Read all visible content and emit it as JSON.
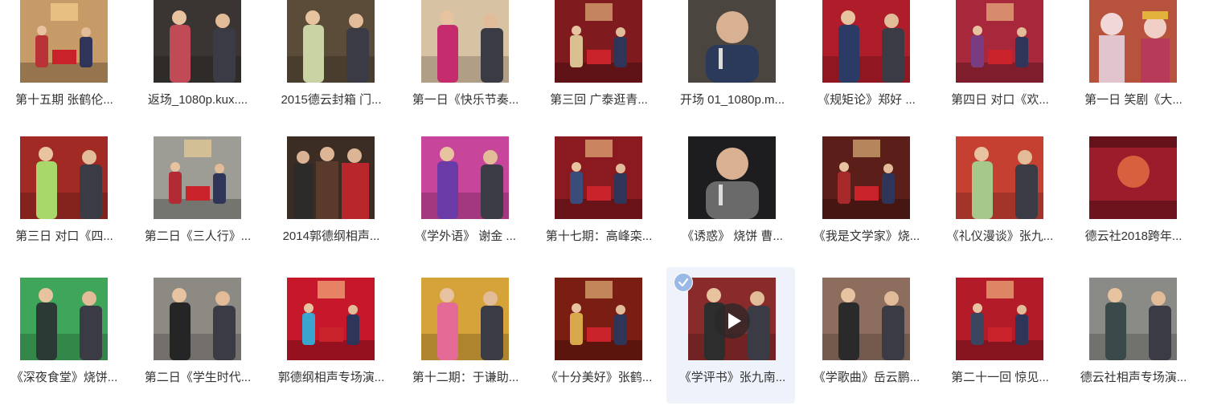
{
  "colors": {
    "caption_text": "#333333",
    "selected_bg": "#eef3fb",
    "check_badge": "#9bb9e6"
  },
  "items": [
    {
      "title": "第十五期 张鹤伦...",
      "bg": "#c79b68",
      "accent": "#b83238",
      "scene": "stage"
    },
    {
      "title": "返场_1080p.kux....",
      "bg": "#3a3532",
      "accent": "#c04a55",
      "scene": "duo"
    },
    {
      "title": "2015德云封箱 门...",
      "bg": "#5a4c38",
      "accent": "#c9d3a4",
      "scene": "duo"
    },
    {
      "title": "第一日《快乐节奏...",
      "bg": "#d7c3a4",
      "accent": "#c52c6d",
      "scene": "duo"
    },
    {
      "title": "第三回 广泰逛青...",
      "bg": "#7f1a1f",
      "accent": "#d8c090",
      "scene": "stage"
    },
    {
      "title": "开场 01_1080p.m...",
      "bg": "#4b4540",
      "accent": "#2b3a5a",
      "scene": "close"
    },
    {
      "title": "《规矩论》郑好 ...",
      "bg": "#b01d2a",
      "accent": "#2c3a66",
      "scene": "duo"
    },
    {
      "title": "第四日 对口《欢...",
      "bg": "#a8283b",
      "accent": "#7a3c80",
      "scene": "stage"
    },
    {
      "title": "第一日 笑剧《大...",
      "bg": "#b7533d",
      "accent": "#e2c4cf",
      "scene": "opera"
    },
    {
      "title": "第三日 对口《四...",
      "bg": "#a12a24",
      "accent": "#a8d86a",
      "scene": "duo"
    },
    {
      "title": "第二日《三人行》...",
      "bg": "#9d9c95",
      "accent": "#b22b34",
      "scene": "stage"
    },
    {
      "title": "2014郭德纲相声...",
      "bg": "#3b2d24",
      "accent": "#b9262c",
      "scene": "group"
    },
    {
      "title": "《学外语》 谢金 ...",
      "bg": "#c8459c",
      "accent": "#6a3aa6",
      "scene": "duo"
    },
    {
      "title": "第十七期：高峰栾...",
      "bg": "#8a1a20",
      "accent": "#3a4d7a",
      "scene": "stage"
    },
    {
      "title": "《诱惑》 烧饼 曹...",
      "bg": "#1d1d1f",
      "accent": "#6a6a6a",
      "scene": "close"
    },
    {
      "title": "《我是文学家》烧...",
      "bg": "#5c1e18",
      "accent": "#a62a2a",
      "scene": "stage"
    },
    {
      "title": "《礼仪漫谈》张九...",
      "bg": "#c64032",
      "accent": "#a6c88a",
      "scene": "duo"
    },
    {
      "title": "德云社2018跨年...",
      "bg": "#9b1c2a",
      "accent": "#d8603f",
      "scene": "curtain"
    },
    {
      "title": "《深夜食堂》烧饼...",
      "bg": "#3fa55a",
      "accent": "#2c3a35",
      "scene": "duo"
    },
    {
      "title": "第二日《学生时代...",
      "bg": "#8d8983",
      "accent": "#252525",
      "scene": "duo"
    },
    {
      "title": "郭德纲相声专场演...",
      "bg": "#c7172a",
      "accent": "#3aa6cf",
      "scene": "stage"
    },
    {
      "title": "第十二期：于谦助...",
      "bg": "#d6a23a",
      "accent": "#e46b96",
      "scene": "duo"
    },
    {
      "title": "《十分美好》张鹤...",
      "bg": "#7a1d12",
      "accent": "#d8a84a",
      "scene": "stage"
    },
    {
      "title": "《学评书》张九南...",
      "bg": "#8a2b2b",
      "accent": "#2d2d2d",
      "scene": "duo",
      "selected": true,
      "play": true
    },
    {
      "title": "《学歌曲》岳云鹏...",
      "bg": "#8d6e5e",
      "accent": "#2a2a2a",
      "scene": "duo"
    },
    {
      "title": "第二十一回 惊见...",
      "bg": "#b31b29",
      "accent": "#3a4560",
      "scene": "stage"
    },
    {
      "title": "德云社相声专场演...",
      "bg": "#8a8a87",
      "accent": "#3a4a4a",
      "scene": "duo"
    }
  ]
}
